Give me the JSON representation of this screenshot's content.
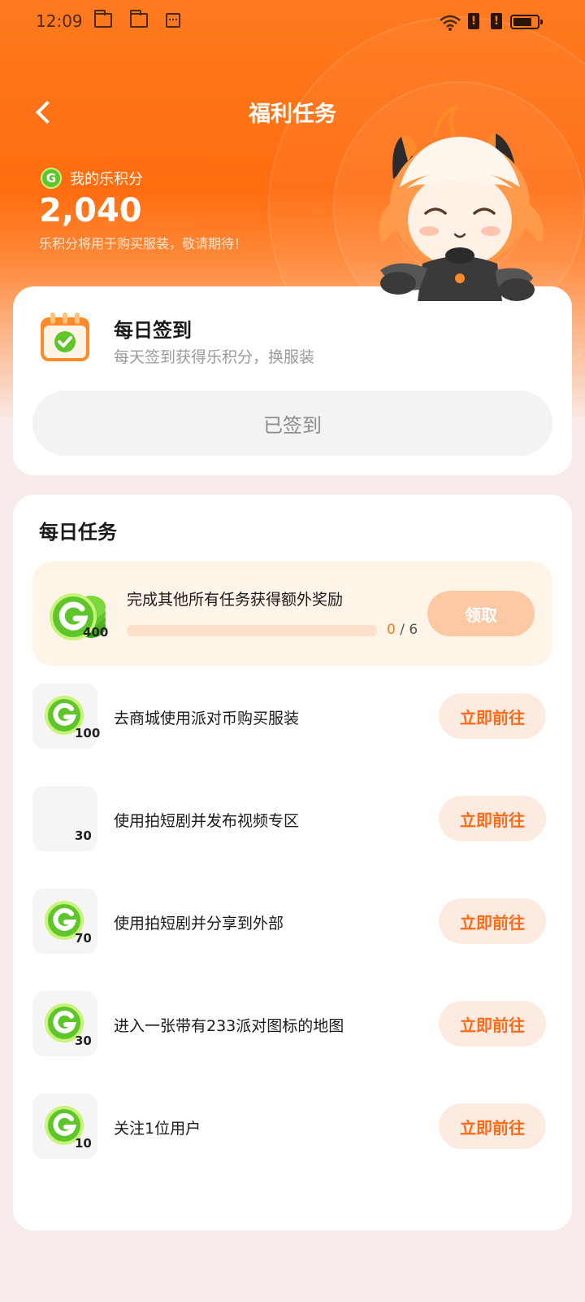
{
  "status_bar": {
    "time": "12:09"
  },
  "header": {
    "title": "福利任务"
  },
  "points": {
    "label": "我的乐积分",
    "value": "2,040",
    "note": "乐积分将用于购买服装，敬请期待！"
  },
  "checkin": {
    "title": "每日签到",
    "subtitle": "每天签到获得乐积分，换服装",
    "button_label": "已签到"
  },
  "daily_tasks": {
    "title": "每日任务",
    "bonus": {
      "reward": "400",
      "text": "完成其他所有任务获得额外奖励",
      "progress_current": "0",
      "progress_sep": "/",
      "progress_total": "6",
      "progress_fraction": 0,
      "button_label": "领取"
    },
    "tasks": [
      {
        "reward": "100",
        "label": "去商城使用派对币购买服装",
        "button_label": "立即前往",
        "has_coin_icon": true
      },
      {
        "reward": "30",
        "label": "使用拍短剧并发布视频专区",
        "button_label": "立即前往",
        "has_coin_icon": false
      },
      {
        "reward": "70",
        "label": "使用拍短剧并分享到外部",
        "button_label": "立即前往",
        "has_coin_icon": true
      },
      {
        "reward": "30",
        "label": "进入一张带有233派对图标的地图",
        "button_label": "立即前往",
        "has_coin_icon": true
      },
      {
        "reward": "10",
        "label": "关注1位用户",
        "button_label": "立即前往",
        "has_coin_icon": true
      }
    ]
  },
  "colors": {
    "accent": "#ff6a15",
    "coin": "#5ec62a",
    "page_bg": "#f9ebe9"
  },
  "icons": [
    "back-arrow-icon",
    "folder-icon",
    "calendar-icon",
    "wifi-icon",
    "alert-icon",
    "battery-icon",
    "coin-icon",
    "checkin-calendar-icon"
  ]
}
